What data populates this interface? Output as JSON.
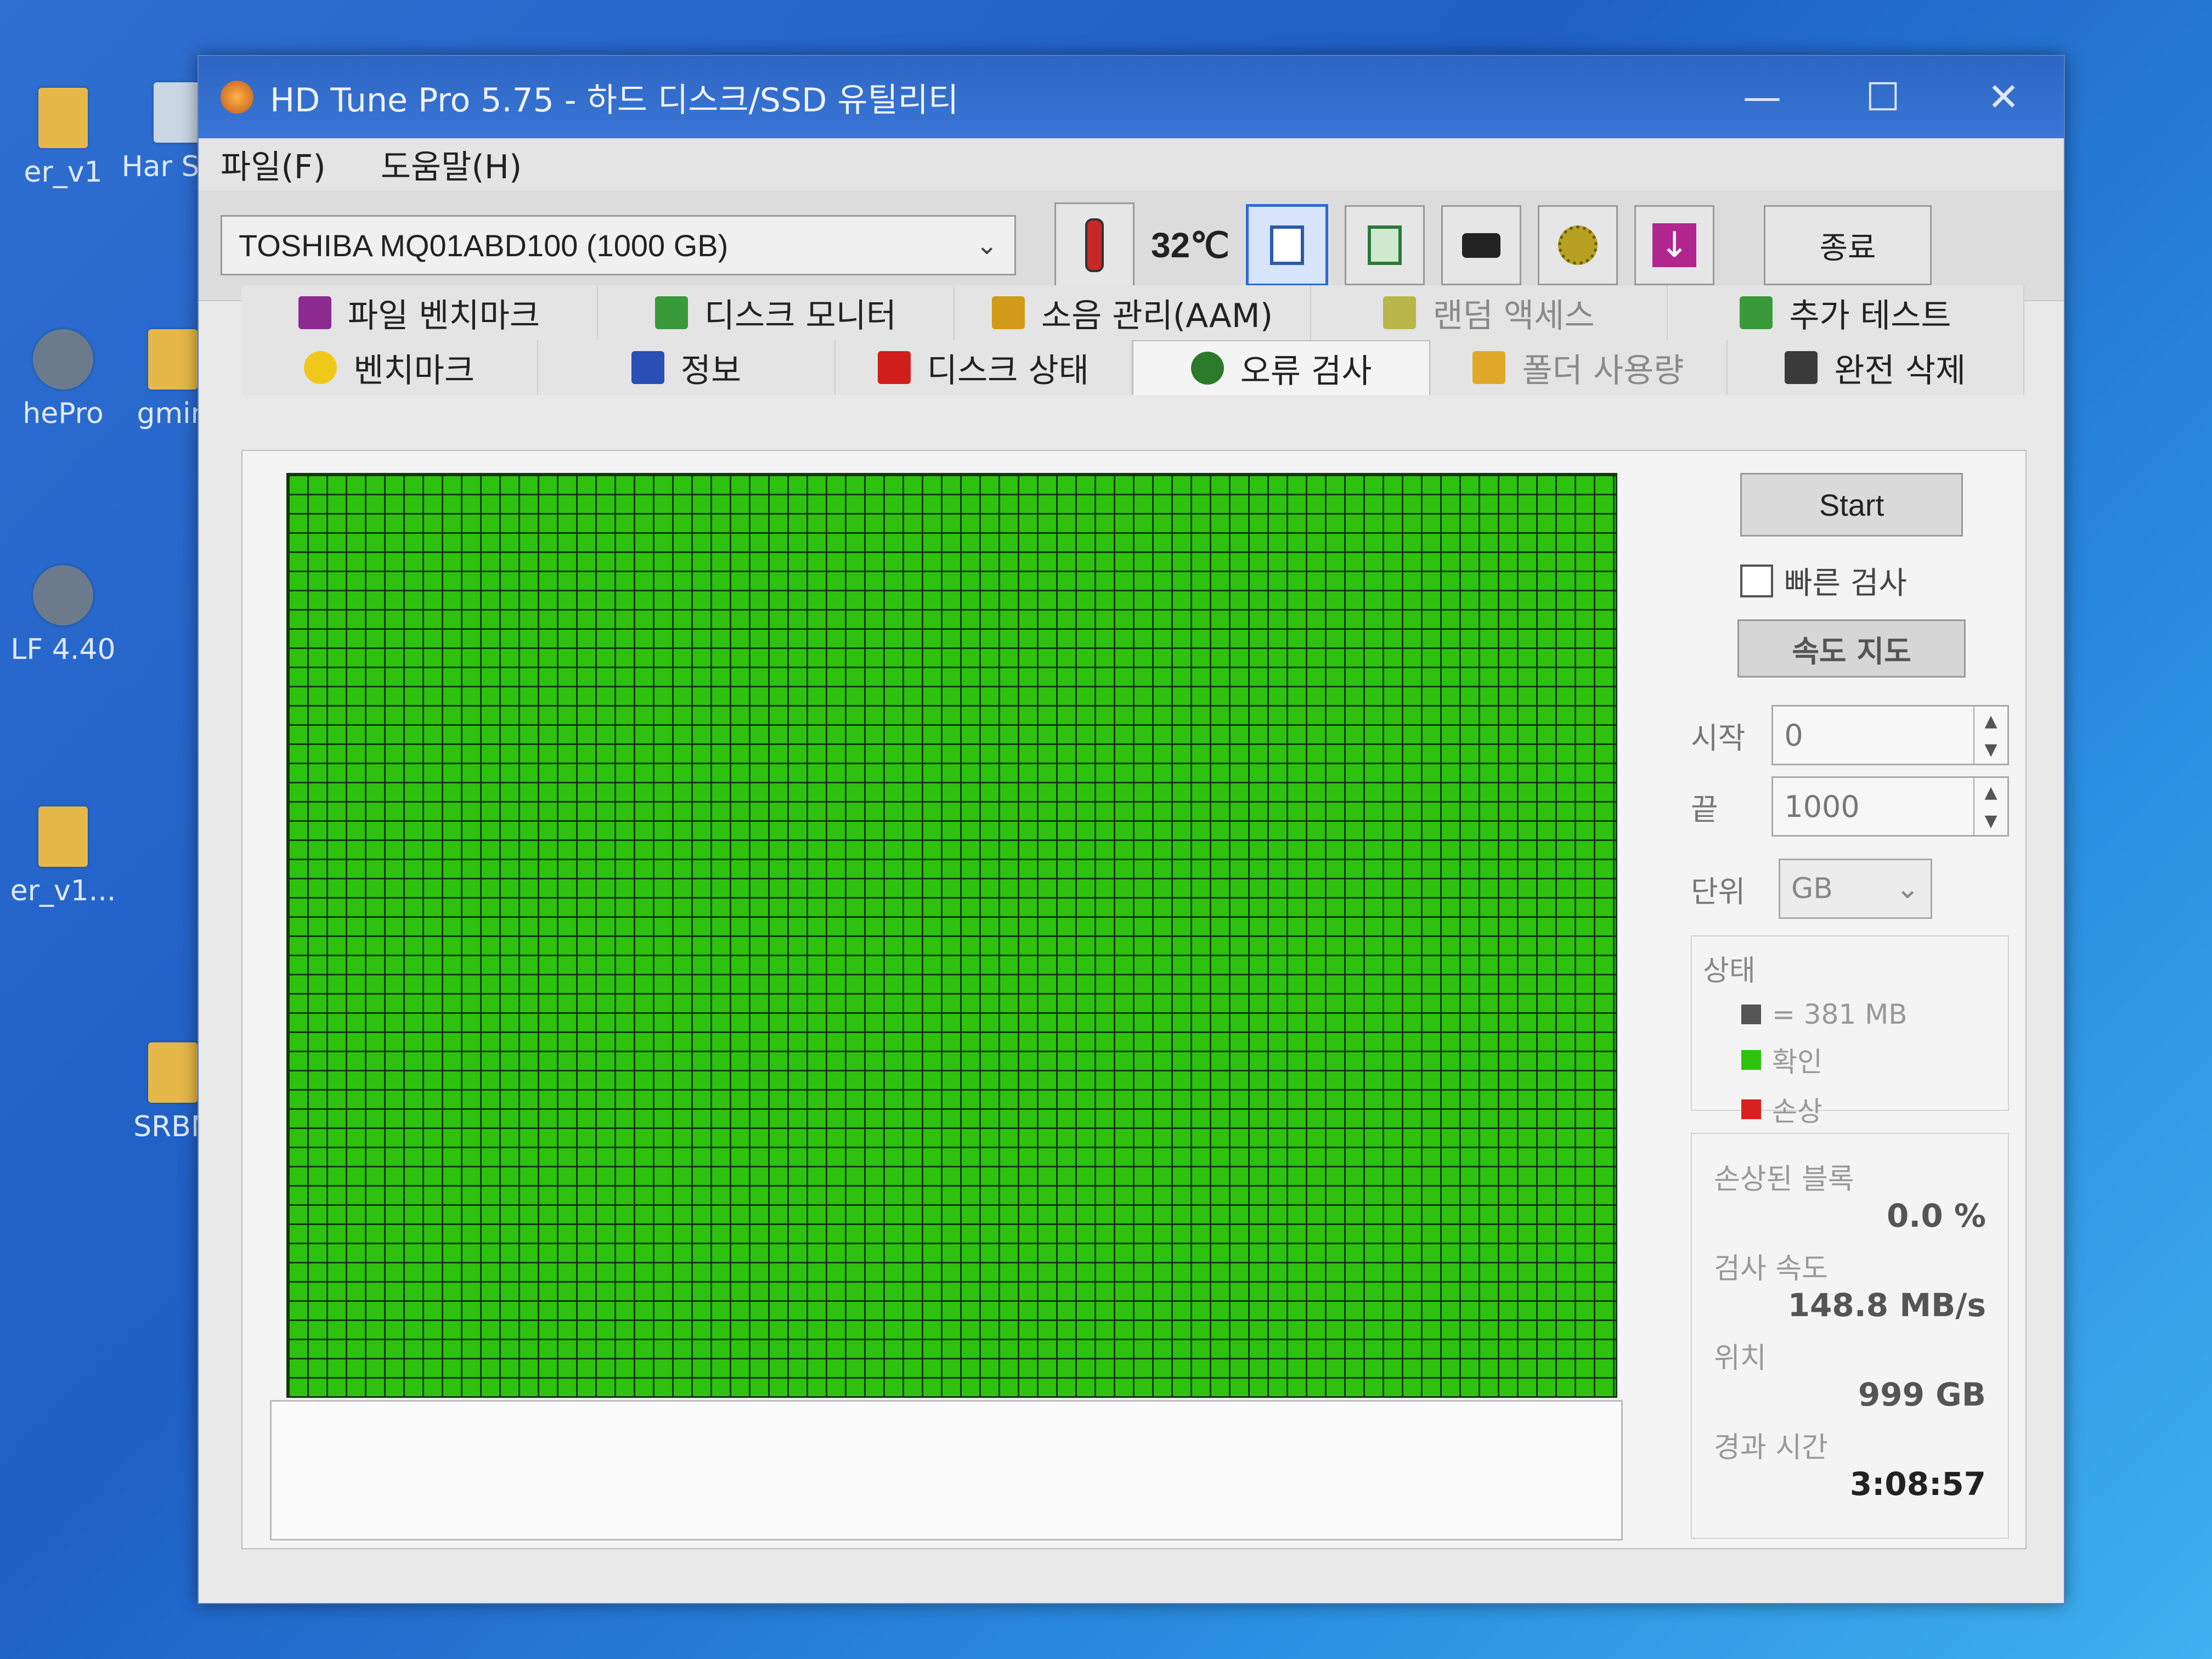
{
  "desktop": {
    "icons": [
      {
        "label": "er_v1"
      },
      {
        "label": "Har Sen"
      },
      {
        "label": "hePro"
      },
      {
        "label": "gmin"
      },
      {
        "label": "LF 4.40"
      },
      {
        "label": "er_v1..."
      },
      {
        "label": "SRBN"
      }
    ]
  },
  "window": {
    "title": "HD Tune Pro 5.75 - 하드 디스크/SSD 유틸리티",
    "minimize": "—",
    "maximize": "☐",
    "close": "✕"
  },
  "menu": {
    "file": "파일(F)",
    "help": "도움말(H)"
  },
  "toolbar": {
    "drive": "TOSHIBA MQ01ABD100 (1000 GB)",
    "temperature": "32℃",
    "exit": "종료"
  },
  "tabs": {
    "row1": [
      {
        "label": "파일 벤치마크",
        "icon": "file-benchmark-icon"
      },
      {
        "label": "디스크 모니터",
        "icon": "disk-monitor-icon"
      },
      {
        "label": "소음 관리(AAM)",
        "icon": "speaker-icon"
      },
      {
        "label": "랜덤 액세스",
        "icon": "random-access-icon"
      },
      {
        "label": "추가 테스트",
        "icon": "extra-tests-icon"
      }
    ],
    "row2": [
      {
        "label": "벤치마크",
        "icon": "lightbulb-icon"
      },
      {
        "label": "정보",
        "icon": "info-icon"
      },
      {
        "label": "디스크 상태",
        "icon": "health-cross-icon"
      },
      {
        "label": "오류 검사",
        "icon": "magnifier-icon"
      },
      {
        "label": "폴더 사용량",
        "icon": "folder-icon"
      },
      {
        "label": "완전 삭제",
        "icon": "trash-icon"
      }
    ],
    "active": "오류 검사"
  },
  "error_scan": {
    "start_button": "Start",
    "quick_scan_label": "빠른 검사",
    "quick_scan_checked": false,
    "speed_map_button": "속도 지도",
    "start_label": "시작",
    "start_value": "0",
    "end_label": "끝",
    "end_value": "1000",
    "unit_label": "단위",
    "unit_value": "GB",
    "legend_title": "상태",
    "legend": [
      {
        "label": "= 381 MB",
        "color": "#555555"
      },
      {
        "label": "확인",
        "color": "#2ec20f"
      },
      {
        "label": "손상",
        "color": "#d92020"
      }
    ],
    "damaged_blocks_label": "손상된 블록",
    "damaged_blocks_value": "0.0 %",
    "scan_speed_label": "검사 속도",
    "scan_speed_value": "148.8 MB/s",
    "position_label": "위치",
    "position_value": "999 GB",
    "elapsed_label": "경과 시간",
    "elapsed_value": "3:08:57"
  },
  "colors": {
    "block_ok": "#2ec20f",
    "grid_line": "#0f3a08",
    "titlebar": "#2e66c4"
  }
}
